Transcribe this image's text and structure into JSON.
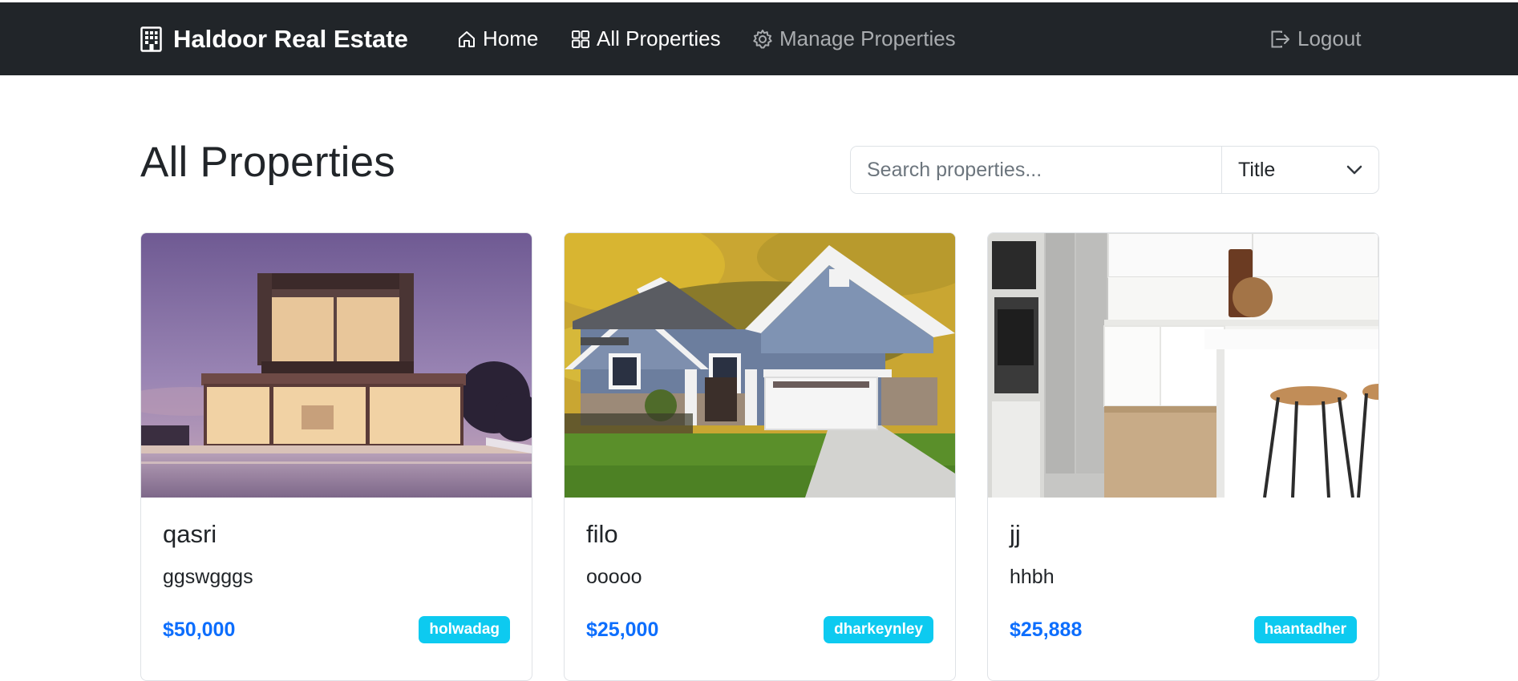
{
  "navbar": {
    "brand": "Haldoor Real Estate",
    "brand_icon": "building-icon",
    "links": [
      {
        "label": "Home",
        "icon": "house-icon"
      },
      {
        "label": "All Properties",
        "icon": "grid-icon"
      },
      {
        "label": "Manage Properties",
        "icon": "gear-icon"
      }
    ],
    "logout": {
      "label": "Logout",
      "icon": "logout-icon"
    },
    "background_color": "#212529"
  },
  "main": {
    "title": "All Properties",
    "search": {
      "placeholder": "Search properties...",
      "value": ""
    },
    "sort": {
      "selected": "Title",
      "icon": "chevron-down-icon"
    }
  },
  "properties": [
    {
      "title": "qasri",
      "description": "ggswgggs",
      "price": "$50,000",
      "owner": "holwadag",
      "image": "modern-villa-with-pool-night"
    },
    {
      "title": "filo",
      "description": "ooooo",
      "price": "$25,000",
      "owner": "dharkeynley",
      "image": "blue-suburban-house-autumn-hills"
    },
    {
      "title": "jj",
      "description": "hhbh",
      "price": "$25,888",
      "owner": "haantadher",
      "image": "white-kitchen-bar-stools"
    }
  ],
  "colors": {
    "price": "#0d6efd",
    "badge": "#0dcaf0"
  }
}
